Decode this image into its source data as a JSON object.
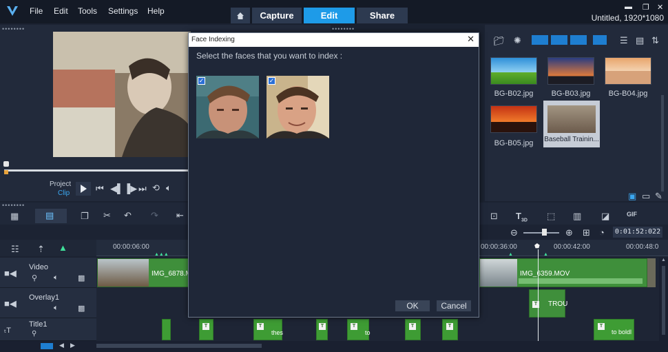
{
  "menu": {
    "file": "File",
    "edit": "Edit",
    "tools": "Tools",
    "settings": "Settings",
    "help": "Help"
  },
  "tabs": {
    "capture": "Capture",
    "edit": "Edit",
    "share": "Share"
  },
  "project_title": "Untitled, 1920*1080",
  "player": {
    "project_label": "Project",
    "clip_label": "Clip"
  },
  "library": {
    "items": [
      {
        "label": "BG-B02.jpg"
      },
      {
        "label": "BG-B03.jpg"
      },
      {
        "label": "BG-B04.jpg"
      },
      {
        "label": "BG-B05.jpg"
      },
      {
        "label": "Baseball Trainin..."
      }
    ]
  },
  "timecode": "0:01:52:022",
  "ruler": {
    "t1": "00:00:06:00",
    "t2": "00:00:36:00",
    "t3": "00:00:42:00",
    "t4": "00:00:48:0"
  },
  "tracks": {
    "video": "Video",
    "overlay": "Overlay1",
    "title": "Title1"
  },
  "clips": {
    "video1": "IMG_6878.M",
    "video2": "IMG_6359.MOV",
    "overlay1": "TROU",
    "title1": "thes",
    "title2": "to",
    "title3": "to boldl"
  },
  "dialog": {
    "title": "Face Indexing",
    "prompt": "Select the faces that you want to index :",
    "ok": "OK",
    "cancel": "Cancel"
  },
  "colors": {
    "accent": "#1e9be8",
    "clip_green": "#3f8f3b",
    "title_green": "#3e9c34"
  }
}
